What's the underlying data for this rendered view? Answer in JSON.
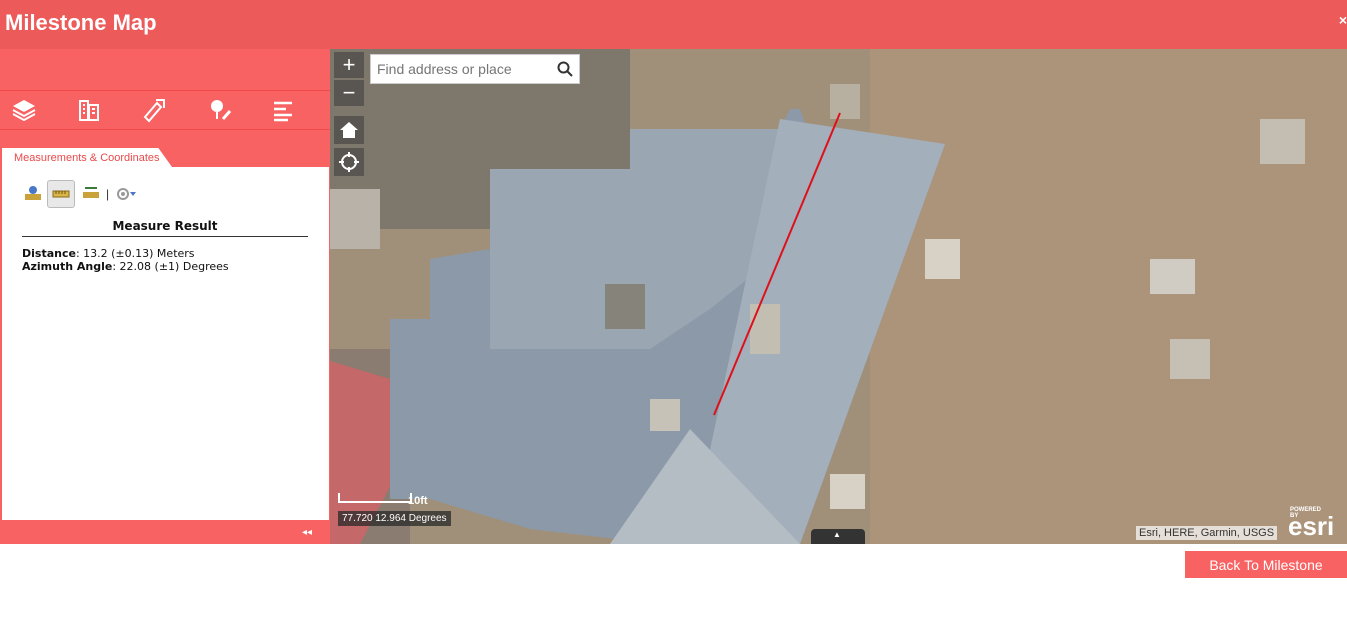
{
  "app": {
    "title": "Milestone Map",
    "close_label": "×"
  },
  "toolbar": {
    "icons": [
      "layers-icon",
      "buildings-icon",
      "measure-tool-icon",
      "edit-icon",
      "menu-icon"
    ]
  },
  "widget": {
    "tab_label": "Measurements & Coordinates",
    "tools": [
      "area-measure-icon",
      "distance-measure-icon",
      "location-measure-icon",
      "settings-icon"
    ],
    "separator": "|",
    "result_title": "Measure Result",
    "distance_label": "Distance",
    "distance_value": ": 13.2 (±0.13) Meters",
    "azimuth_label": "Azimuth Angle",
    "azimuth_value": ": 22.08 (±1) Degrees"
  },
  "collapse_label": "◂◂",
  "map": {
    "zoom_in": "+",
    "zoom_out": "−",
    "search_placeholder": "Find address or place",
    "scale_label": "10ft",
    "coordinates": "77.720 12.964 Degrees",
    "attribution": "Esri, HERE, Garmin, USGS",
    "powered_by": "POWERED BY",
    "esri_logo": "esri",
    "drawer_arrow": "▲",
    "measure_line_color": "#e0101a"
  },
  "footer": {
    "back_button": "Back To Milestone"
  },
  "colors": {
    "accent": "#f86262",
    "titlebar": "#ec5a5a"
  }
}
